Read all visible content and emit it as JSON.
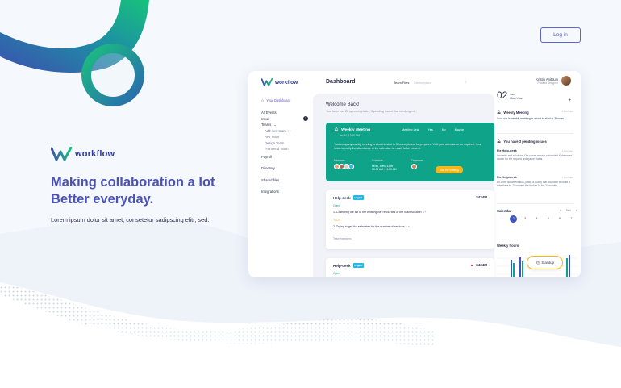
{
  "header": {
    "login_label": "Log in"
  },
  "hero": {
    "brand": "workflow",
    "headline_1": "Making collaboration a lot",
    "headline_2": "Better everyday.",
    "tagline": "Lorem ipsum dolor sit amet, consetetur sadipscing elitr, sed."
  },
  "app": {
    "brand": "workflow",
    "title": "Dashboard",
    "tabs": [
      {
        "label": "Team Files"
      },
      {
        "label": "Marketplace"
      }
    ],
    "sidebar": {
      "items": [
        {
          "label": "Your Dashboard",
          "icon": "diamond-icon"
        },
        {
          "label": "All Events"
        },
        {
          "label": "Inbox",
          "badge": "3"
        },
        {
          "label": "Teams"
        },
        {
          "label": "Add new team ++"
        },
        {
          "label": "API Team"
        },
        {
          "label": "Design Team"
        },
        {
          "label": "Front-end Team"
        },
        {
          "label": "Payroll"
        },
        {
          "label": "Directory"
        },
        {
          "label": "Shared files"
        },
        {
          "label": "Integrations"
        }
      ]
    },
    "welcome": {
      "title": "Welcome Back!",
      "subtitle": "Your team has 20 upcoming tasks, 3 pending issues that need urgent..."
    },
    "meeting": {
      "title": "Weekly Meeting",
      "subtitle": "Jan 24, 12:00 PM",
      "options": [
        "Meeting Link",
        "Yes",
        "No",
        "Maybe"
      ],
      "description": "Your company weekly meeting is about to start in 3 hours, please be prepared. Visit your attendance as required. Your hosts to notify the attendance at the calendar. be ready to be present.",
      "members_label": "Members",
      "schedule_label": "Schedule",
      "schedule_value": "Mon, Dec 15th",
      "schedule_time": "10:00 AM - 11:00 AM",
      "organizer_label": "Organizer",
      "join_label": "Join the meeting"
    },
    "tasks": [
      {
        "title": "Help-desk",
        "tag": "Urgent",
        "amount": "$434M",
        "status_1": "Open",
        "line_1": "1. Collecting the list of the existing bar resources of the main solution",
        "status_2": "To Do",
        "line_2": "2. Trying to get the estimates for the number of services",
        "footer": "Team members"
      },
      {
        "title": "Help-desk",
        "tag": "Urgent",
        "amount": "$434M",
        "status_1": "Open"
      }
    ],
    "user": {
      "name": "Kristin Anitquin",
      "role": "Product Designer"
    },
    "date": {
      "day": "02",
      "month": "Jan",
      "weekday": "Mon-Year"
    },
    "reminder": {
      "title": "Weekly Meeting",
      "time": "1 hour ago",
      "text": "Your our is weekly meeting is about to start in 3 hours."
    },
    "issues_header": "You have 3 pending issues",
    "issues": [
      {
        "title": "Fix Help-desk",
        "time": "1 hour ago",
        "text": "Incidents and solutions. Our server reports a standard Kubernetes cluster for the request and queue status."
      },
      {
        "title": "Fix Help-desk",
        "time": "1 hour ago",
        "text": "An open documentation, patch a quality that you have to make a note there to. Document the feature to the 24 months."
      }
    ],
    "calendar": {
      "title": "Calendar",
      "prev": "‹",
      "next": "›",
      "month_label": "Jan",
      "days": [
        "1",
        "2",
        "3",
        "4",
        "5",
        "6",
        "7"
      ],
      "selected": "2"
    },
    "weekly_hours": {
      "title": "Weekly hours",
      "standup_label": "Standup",
      "standup_icon": "wave-hand-icon"
    }
  },
  "colors": {
    "accent": "#4a52b5",
    "teal": "#0fa389",
    "yellow": "#f5b619",
    "blue": "#3d54c2"
  }
}
